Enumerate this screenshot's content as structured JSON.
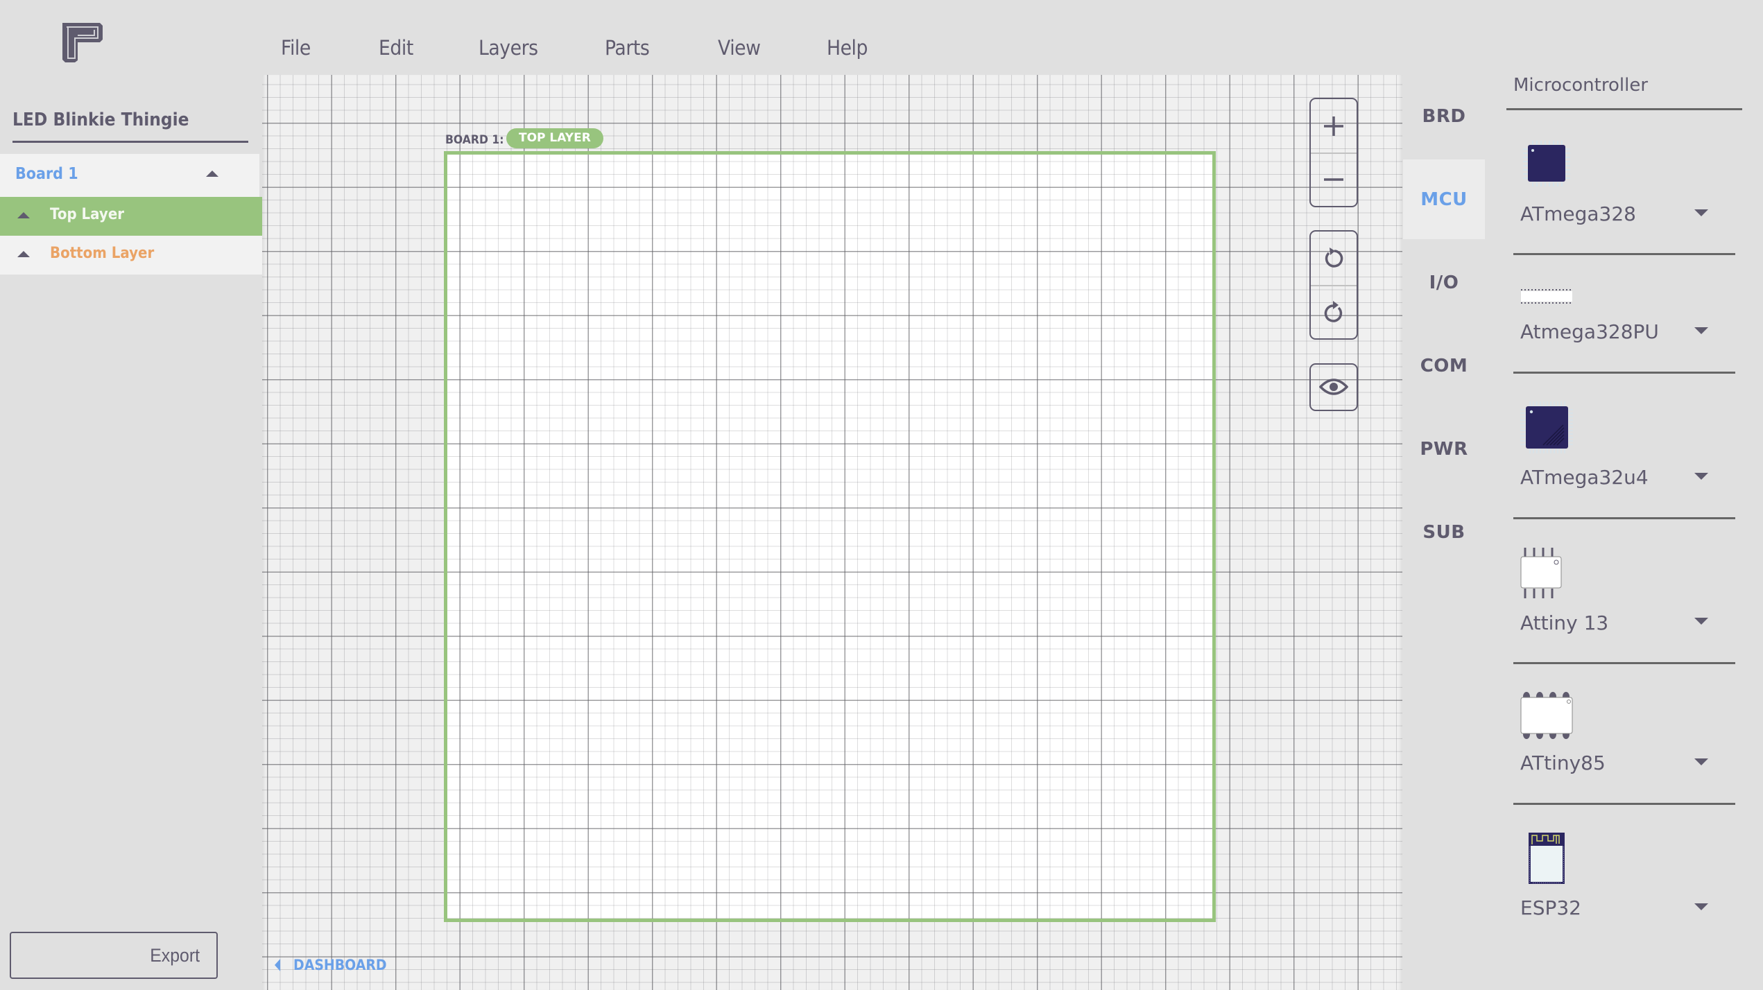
{
  "app": {
    "logo_icon": "pcb-app-logo"
  },
  "menu": [
    {
      "label": "File"
    },
    {
      "label": "Edit"
    },
    {
      "label": "Layers"
    },
    {
      "label": "Parts"
    },
    {
      "label": "View"
    },
    {
      "label": "Help"
    }
  ],
  "sidebar": {
    "project_title": "LED Blinkie Thingie",
    "board": {
      "label": "Board 1",
      "expand_icon": "triangle-up-icon"
    },
    "layers": [
      {
        "label": "Top Layer",
        "state": "active",
        "icon": "triangle-up-icon"
      },
      {
        "label": "Bottom Layer",
        "state": "inactive",
        "icon": "triangle-up-icon"
      }
    ],
    "export_label": "Export"
  },
  "canvas": {
    "board_label": "BOARD 1:",
    "layer_pill": "TOP LAYER",
    "dashboard_link": "DASHBOARD",
    "controls": {
      "zoom_in": "plus-icon",
      "zoom_out": "minus-icon",
      "rotate_ccw": "rotate-ccw-icon",
      "rotate_cw": "rotate-cw-icon",
      "visibility": "eye-icon"
    }
  },
  "categories": [
    {
      "label": "BRD",
      "active": false
    },
    {
      "label": "MCU",
      "active": true
    },
    {
      "label": "I/O",
      "active": false
    },
    {
      "label": "COM",
      "active": false
    },
    {
      "label": "PWR",
      "active": false
    },
    {
      "label": "SUB",
      "active": false
    }
  ],
  "parts_panel": {
    "title": "Microcontroller",
    "parts": [
      {
        "name": "ATmega328",
        "icon": "tqfp-chip-icon"
      },
      {
        "name": "Atmega328PU",
        "icon": "dip28-chip-icon"
      },
      {
        "name": "ATmega32u4",
        "icon": "tqfp44-chip-icon"
      },
      {
        "name": "Attiny 13",
        "icon": "soic8-chip-icon"
      },
      {
        "name": "ATtiny85",
        "icon": "dip8-chip-icon"
      },
      {
        "name": "ESP32",
        "icon": "esp32-module-icon"
      }
    ]
  },
  "colors": {
    "accent_blue": "#6aa0e8",
    "layer_green": "#98c47e",
    "bottom_layer_orange": "#eaa365",
    "text_dark": "#5f5b6e",
    "chip_navy": "#2b2660"
  }
}
